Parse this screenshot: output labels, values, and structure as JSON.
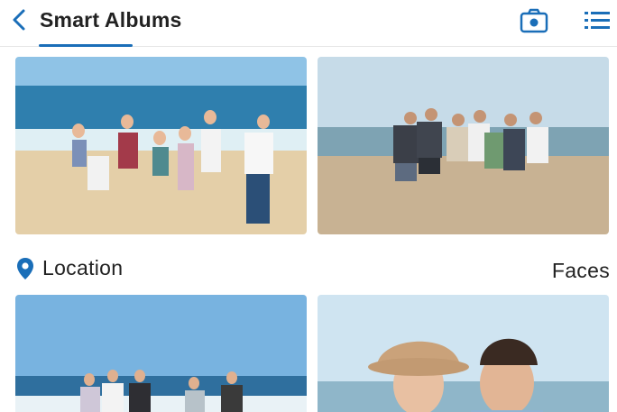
{
  "header": {
    "title": "Smart Albums",
    "back_icon": "chevron-left-icon",
    "camera_icon": "camera-icon",
    "list_icon": "list-icon",
    "accent": "#1a6eb8"
  },
  "sections": {
    "location_label": "Location",
    "faces_label": "Faces",
    "location_icon": "map-pin-icon"
  },
  "photos": [
    {
      "subject": "group of friends waving on beach"
    },
    {
      "subject": "group of friends standing on beach"
    },
    {
      "subject": "group of friends waving on beach by sea"
    },
    {
      "subject": "couple smiling on beach"
    }
  ]
}
